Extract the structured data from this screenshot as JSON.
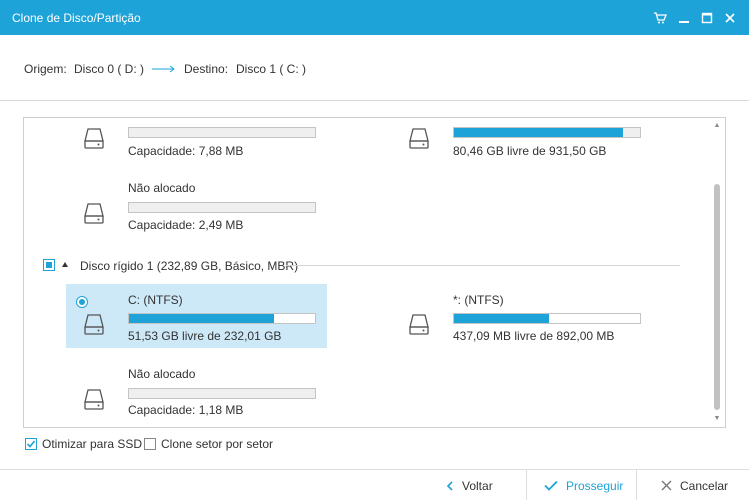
{
  "window": {
    "title": "Clone de Disco/Partição",
    "accent_color": "#1ea3d8",
    "controls": [
      "cart-icon",
      "minimize-icon",
      "maximize-icon",
      "close-icon"
    ]
  },
  "path": {
    "source_label": "Origem:",
    "source_value": "Disco 0 ( D: )",
    "dest_label": "Destino:",
    "dest_value": "Disco 1 ( C: )"
  },
  "disk0": {
    "partitions": [
      {
        "name": "",
        "info": "Capacidade: 7,88 MB",
        "fill": 0
      },
      {
        "name": "",
        "info": "80,46 GB livre de 931,50 GB",
        "fill": 0.91
      },
      {
        "name": "Não alocado",
        "info": "Capacidade: 2,49 MB",
        "fill": 0
      }
    ]
  },
  "disk1": {
    "header": "Disco rígido 1 (232,89 GB, Básico, MBR)",
    "partitions": [
      {
        "name": "C: (NTFS)",
        "info": "51,53 GB livre de 232,01 GB",
        "fill": 0.78,
        "selected": true
      },
      {
        "name": "*: (NTFS)",
        "info": "437,09 MB livre de 892,00 MB",
        "fill": 0.51
      },
      {
        "name": "Não alocado",
        "info": "Capacidade: 1,18 MB",
        "fill": 0
      }
    ]
  },
  "options": {
    "optimize_ssd": {
      "label": "Otimizar para SSD",
      "checked": true
    },
    "sector_clone": {
      "label": "Clone setor por setor",
      "checked": false
    }
  },
  "footer": {
    "back": "Voltar",
    "next": "Prosseguir",
    "cancel": "Cancelar"
  }
}
